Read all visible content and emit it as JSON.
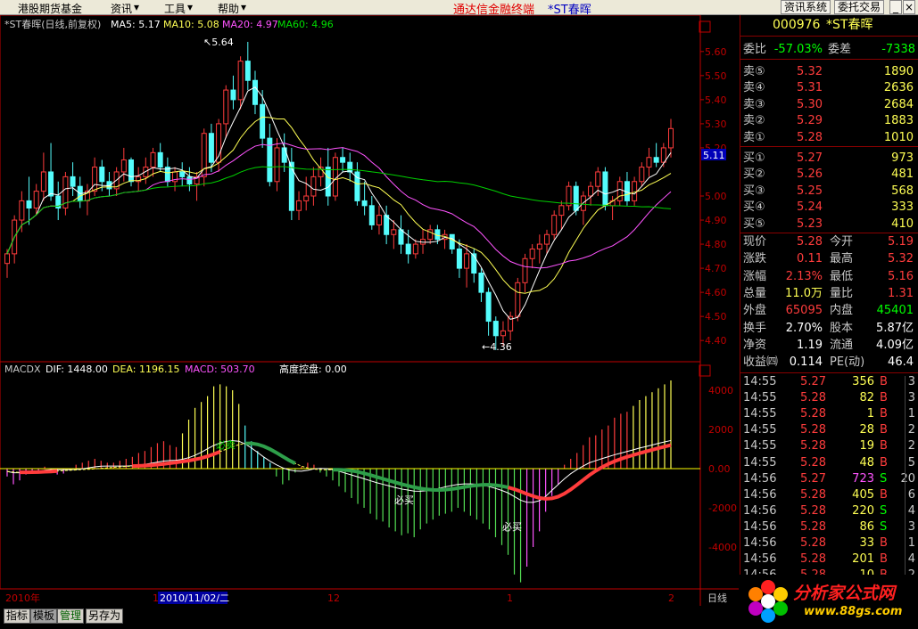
{
  "menu": {
    "items": [
      "港股期货基金",
      "资讯",
      "工具",
      "帮助"
    ],
    "app_title": "通达信金融终端",
    "stock_title": "*ST春晖",
    "buttons": [
      "资讯系统",
      "委托交易"
    ]
  },
  "legend": {
    "title": "*ST春晖(日线,前复权)",
    "ma5": "MA5: 5.17",
    "ma10": "MA10: 5.08",
    "ma20": "MA20: 4.97",
    "ma60": "MA60: 4.96"
  },
  "colors": {
    "up": "#ff3c3c",
    "down": "#54fcfc",
    "ma5": "#ffffff",
    "ma10": "#ffff54",
    "ma20": "#ff54ff",
    "ma60": "#00d000",
    "axis": "#c00000",
    "yellow": "#ffff00"
  },
  "price_axis": {
    "ticks": [
      "5.60",
      "5.50",
      "5.40",
      "5.30",
      "5.20",
      "5.11",
      "5.00",
      "4.90",
      "4.80",
      "4.70",
      "4.60",
      "4.50",
      "4.40"
    ],
    "current": "5.11"
  },
  "annotations": {
    "high": "5.64",
    "low": "4.36"
  },
  "macd": {
    "title": "MACDX",
    "dif": "DIF: 1448.00",
    "dea": "DEA: 1196.15",
    "macd": "MACD: 503.70",
    "control": "高度控盘: 0.00",
    "ticks": [
      "4000",
      "2000",
      "0.00",
      "-2000",
      "-4000"
    ],
    "buy1": "必买",
    "buy2": "必买",
    "sell": "必卖"
  },
  "time_axis": {
    "labels": [
      "2010年",
      "1",
      "2010/11/02/二",
      "12",
      "1",
      "2"
    ],
    "period": "日线"
  },
  "bottom_tabs": [
    "指标",
    "模板",
    "管理",
    "另存为"
  ],
  "quote": {
    "code": "000976",
    "name": "*ST春晖",
    "weibi_label": "委比",
    "weibi": "-57.03%",
    "weicha_label": "委差",
    "weicha": "-7338",
    "asks": [
      {
        "label": "卖⑤",
        "price": "5.32",
        "vol": "1890"
      },
      {
        "label": "卖④",
        "price": "5.31",
        "vol": "2636"
      },
      {
        "label": "卖③",
        "price": "5.30",
        "vol": "2684"
      },
      {
        "label": "卖②",
        "price": "5.29",
        "vol": "1883"
      },
      {
        "label": "卖①",
        "price": "5.28",
        "vol": "1010"
      }
    ],
    "bids": [
      {
        "label": "买①",
        "price": "5.27",
        "vol": "973"
      },
      {
        "label": "买②",
        "price": "5.26",
        "vol": "481"
      },
      {
        "label": "买③",
        "price": "5.25",
        "vol": "568"
      },
      {
        "label": "买④",
        "price": "5.24",
        "vol": "333"
      },
      {
        "label": "买⑤",
        "price": "5.23",
        "vol": "410"
      }
    ],
    "stats": [
      {
        "l1": "现价",
        "v1": "5.28",
        "l2": "今开",
        "v2": "5.19",
        "c1": "#ff3c3c",
        "c2": "#ff3c3c"
      },
      {
        "l1": "涨跌",
        "v1": "0.11",
        "l2": "最高",
        "v2": "5.32",
        "c1": "#ff3c3c",
        "c2": "#ff3c3c"
      },
      {
        "l1": "涨幅",
        "v1": "2.13%",
        "l2": "最低",
        "v2": "5.16",
        "c1": "#ff3c3c",
        "c2": "#ff3c3c"
      },
      {
        "l1": "总量",
        "v1": "11.0万",
        "l2": "量比",
        "v2": "1.31",
        "c1": "#ffff54",
        "c2": "#ff3c3c"
      },
      {
        "l1": "外盘",
        "v1": "65095",
        "l2": "内盘",
        "v2": "45401",
        "c1": "#ff3c3c",
        "c2": "#00ff00"
      },
      {
        "l1": "换手",
        "v1": "2.70%",
        "l2": "股本",
        "v2": "5.87亿",
        "c1": "#ffffff",
        "c2": "#ffffff"
      },
      {
        "l1": "净资",
        "v1": "1.19",
        "l2": "流通",
        "v2": "4.09亿",
        "c1": "#ffffff",
        "c2": "#ffffff"
      },
      {
        "l1": "收益㈣",
        "v1": "0.114",
        "l2": "PE(动)",
        "v2": "46.4",
        "c1": "#ffffff",
        "c2": "#ffffff"
      }
    ],
    "ticks": [
      {
        "t": "14:55",
        "p": "5.27",
        "v": "356",
        "s": "B",
        "n": "3",
        "vc": "#ffff54"
      },
      {
        "t": "14:55",
        "p": "5.28",
        "v": "82",
        "s": "B",
        "n": "3",
        "vc": "#ffff54"
      },
      {
        "t": "14:55",
        "p": "5.28",
        "v": "1",
        "s": "B",
        "n": "1",
        "vc": "#ffff54"
      },
      {
        "t": "14:55",
        "p": "5.28",
        "v": "28",
        "s": "B",
        "n": "2",
        "vc": "#ffff54"
      },
      {
        "t": "14:55",
        "p": "5.28",
        "v": "19",
        "s": "B",
        "n": "2",
        "vc": "#ffff54"
      },
      {
        "t": "14:55",
        "p": "5.28",
        "v": "48",
        "s": "B",
        "n": "5",
        "vc": "#ffff54"
      },
      {
        "t": "14:56",
        "p": "5.27",
        "v": "723",
        "s": "S",
        "n": "20",
        "vc": "#ff54ff"
      },
      {
        "t": "14:56",
        "p": "5.28",
        "v": "405",
        "s": "B",
        "n": "6",
        "vc": "#ffff54"
      },
      {
        "t": "14:56",
        "p": "5.28",
        "v": "220",
        "s": "S",
        "n": "4",
        "vc": "#ffff54"
      },
      {
        "t": "14:56",
        "p": "5.28",
        "v": "86",
        "s": "S",
        "n": "3",
        "vc": "#ffff54"
      },
      {
        "t": "14:56",
        "p": "5.28",
        "v": "33",
        "s": "B",
        "n": "1",
        "vc": "#ffff54"
      },
      {
        "t": "14:56",
        "p": "5.28",
        "v": "201",
        "s": "B",
        "n": "4",
        "vc": "#ffff54"
      },
      {
        "t": "14:56",
        "p": "5.28",
        "v": "10",
        "s": "B",
        "n": "2",
        "vc": "#ffff54"
      }
    ]
  },
  "watermark": {
    "text": "分析家公式网",
    "url": "www.88gs.com"
  },
  "chart_data": [
    {
      "type": "candlestick",
      "title": "*ST春晖(日线,前复权)",
      "ylim": [
        4.36,
        5.64
      ],
      "ohlc": [
        [
          4.72,
          4.78,
          4.66,
          4.76
        ],
        [
          4.76,
          4.92,
          4.72,
          4.9
        ],
        [
          4.9,
          5.02,
          4.85,
          4.98
        ],
        [
          4.98,
          5.08,
          4.88,
          4.95
        ],
        [
          4.95,
          5.05,
          4.92,
          5.02
        ],
        [
          5.02,
          5.18,
          4.98,
          5.1
        ],
        [
          5.1,
          5.22,
          4.98,
          5.0
        ],
        [
          5.0,
          5.06,
          4.9,
          4.95
        ],
        [
          4.95,
          5.1,
          4.92,
          5.08
        ],
        [
          5.08,
          5.14,
          5.0,
          5.04
        ],
        [
          5.04,
          5.08,
          4.95,
          4.98
        ],
        [
          4.98,
          5.05,
          4.92,
          5.02
        ],
        [
          5.02,
          5.16,
          5.0,
          5.12
        ],
        [
          5.12,
          5.15,
          5.02,
          5.06
        ],
        [
          5.06,
          5.1,
          5.0,
          5.03
        ],
        [
          5.03,
          5.12,
          5.0,
          5.1
        ],
        [
          5.1,
          5.2,
          5.06,
          5.15
        ],
        [
          5.15,
          5.16,
          5.04,
          5.06
        ],
        [
          5.06,
          5.12,
          5.02,
          5.08
        ],
        [
          5.08,
          5.16,
          5.05,
          5.12
        ],
        [
          5.12,
          5.2,
          5.08,
          5.18
        ],
        [
          5.18,
          5.22,
          5.1,
          5.12
        ],
        [
          5.12,
          5.16,
          5.04,
          5.06
        ],
        [
          5.06,
          5.12,
          5.02,
          5.1
        ],
        [
          5.1,
          5.14,
          5.04,
          5.08
        ],
        [
          5.08,
          5.12,
          5.02,
          5.05
        ],
        [
          5.05,
          5.1,
          4.98,
          5.08
        ],
        [
          5.08,
          5.28,
          5.04,
          5.26
        ],
        [
          5.26,
          5.3,
          5.1,
          5.14
        ],
        [
          5.14,
          5.32,
          5.1,
          5.3
        ],
        [
          5.3,
          5.46,
          5.24,
          5.44
        ],
        [
          5.44,
          5.5,
          5.36,
          5.4
        ],
        [
          5.4,
          5.58,
          5.36,
          5.56
        ],
        [
          5.56,
          5.64,
          5.44,
          5.48
        ],
        [
          5.48,
          5.52,
          5.34,
          5.38
        ],
        [
          5.38,
          5.44,
          5.2,
          5.24
        ],
        [
          5.24,
          5.3,
          5.04,
          5.06
        ],
        [
          5.06,
          5.24,
          5.02,
          5.2
        ],
        [
          5.2,
          5.26,
          5.1,
          5.14
        ],
        [
          5.14,
          5.2,
          4.9,
          4.94
        ],
        [
          4.94,
          5.02,
          4.9,
          4.98
        ],
        [
          4.98,
          5.08,
          4.94,
          5.0
        ],
        [
          5.0,
          5.12,
          4.96,
          5.08
        ],
        [
          5.08,
          5.16,
          5.04,
          5.12
        ],
        [
          5.12,
          5.2,
          4.96,
          5.0
        ],
        [
          5.0,
          5.18,
          4.98,
          5.16
        ],
        [
          5.16,
          5.2,
          5.1,
          5.14
        ],
        [
          5.14,
          5.18,
          5.06,
          5.1
        ],
        [
          5.1,
          5.14,
          4.96,
          4.98
        ],
        [
          4.98,
          5.06,
          4.92,
          4.96
        ],
        [
          4.96,
          5.0,
          4.86,
          4.88
        ],
        [
          4.88,
          4.96,
          4.84,
          4.92
        ],
        [
          4.92,
          4.96,
          4.8,
          4.84
        ],
        [
          4.84,
          4.9,
          4.78,
          4.86
        ],
        [
          4.86,
          4.92,
          4.76,
          4.8
        ],
        [
          4.8,
          4.86,
          4.72,
          4.76
        ],
        [
          4.76,
          4.82,
          4.74,
          4.8
        ],
        [
          4.8,
          4.86,
          4.76,
          4.82
        ],
        [
          4.82,
          4.88,
          4.8,
          4.86
        ],
        [
          4.86,
          4.88,
          4.8,
          4.82
        ],
        [
          4.82,
          4.86,
          4.78,
          4.84
        ],
        [
          4.84,
          4.84,
          4.76,
          4.78
        ],
        [
          4.78,
          4.82,
          4.66,
          4.7
        ],
        [
          4.7,
          4.8,
          4.62,
          4.76
        ],
        [
          4.76,
          4.78,
          4.64,
          4.68
        ],
        [
          4.68,
          4.7,
          4.56,
          4.6
        ],
        [
          4.6,
          4.62,
          4.42,
          4.48
        ],
        [
          4.48,
          4.5,
          4.36,
          4.42
        ],
        [
          4.42,
          4.48,
          4.38,
          4.44
        ],
        [
          4.44,
          4.52,
          4.4,
          4.5
        ],
        [
          4.5,
          4.66,
          4.48,
          4.64
        ],
        [
          4.64,
          4.76,
          4.6,
          4.74
        ],
        [
          4.74,
          4.8,
          4.7,
          4.78
        ],
        [
          4.78,
          4.84,
          4.72,
          4.8
        ],
        [
          4.8,
          4.86,
          4.76,
          4.84
        ],
        [
          4.84,
          4.94,
          4.82,
          4.92
        ],
        [
          4.92,
          4.98,
          4.86,
          4.96
        ],
        [
          4.96,
          5.06,
          4.94,
          5.04
        ],
        [
          5.04,
          5.06,
          4.92,
          4.94
        ],
        [
          4.94,
          5.02,
          4.88,
          5.0
        ],
        [
          5.0,
          5.06,
          4.96,
          5.04
        ],
        [
          5.04,
          5.12,
          5.0,
          5.1
        ],
        [
          5.1,
          5.12,
          4.94,
          4.96
        ],
        [
          4.96,
          5.0,
          4.9,
          4.98
        ],
        [
          4.98,
          5.08,
          4.96,
          5.06
        ],
        [
          5.06,
          5.1,
          4.96,
          4.98
        ],
        [
          4.98,
          5.08,
          4.96,
          5.06
        ],
        [
          5.06,
          5.14,
          5.04,
          5.12
        ],
        [
          5.12,
          5.2,
          5.08,
          5.16
        ],
        [
          5.16,
          5.22,
          5.12,
          5.14
        ],
        [
          5.14,
          5.22,
          5.12,
          5.2
        ],
        [
          5.2,
          5.32,
          5.16,
          5.28
        ]
      ]
    },
    {
      "type": "bar",
      "title": "MACDX",
      "ylim": [
        -6000,
        5000
      ],
      "values": [
        -400,
        -800,
        -600,
        -300,
        -200,
        -100,
        100,
        -200,
        -300,
        -250,
        -100,
        200,
        300,
        400,
        500,
        400,
        300,
        300,
        400,
        500,
        600,
        800,
        900,
        1100,
        1300,
        1400,
        1200,
        1100,
        1800,
        2500,
        3100,
        3400,
        3700,
        4200,
        4300,
        4200,
        4000,
        3300,
        2200,
        1400,
        900,
        600,
        300,
        -400,
        -800,
        -600,
        -200,
        100,
        300,
        200,
        -200,
        -400,
        -600,
        -900,
        -1200,
        -1500,
        -1800,
        -2000,
        -2300,
        -2600,
        -2700,
        -3000,
        -3200,
        -3400,
        -3300,
        -3500,
        -3100,
        -2800,
        -2600,
        -2400,
        -2300,
        -2200,
        -2000,
        -2200,
        -2400,
        -2600,
        -2800,
        -3100,
        -3500,
        -3900,
        -4400,
        -5400,
        -5800,
        -5000,
        -4000,
        -3200,
        -2200,
        -1400,
        -800,
        200,
        500,
        800,
        1200,
        1600,
        1700,
        2000,
        2200,
        2600,
        2800,
        2900,
        3200,
        3500,
        3700,
        3900,
        4100,
        4300,
        4500
      ]
    }
  ]
}
